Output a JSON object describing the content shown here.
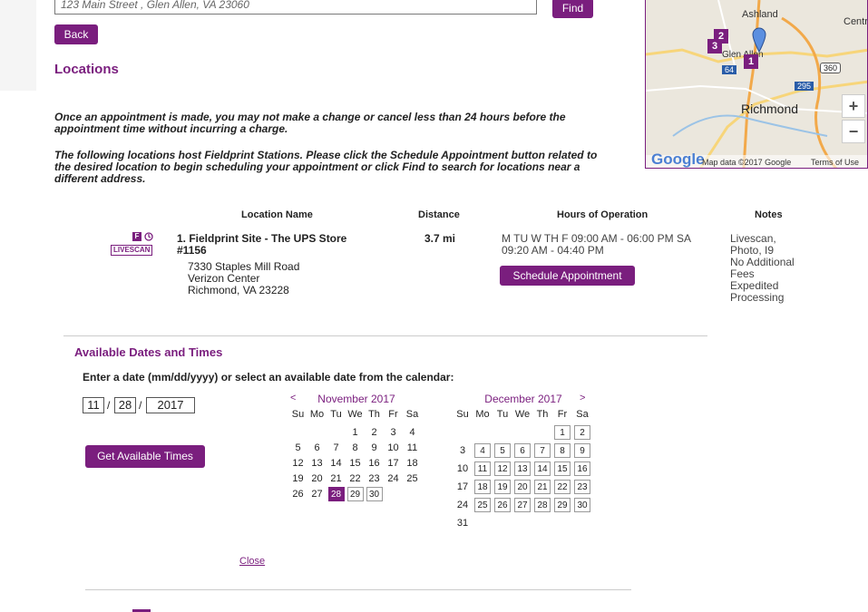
{
  "search": {
    "address_value": "123 Main Street , Glen Allen, VA 23060",
    "find_label": "Find",
    "back_label": "Back"
  },
  "page": {
    "title": "Locations",
    "notice_1": [
      "Once an appointment is made, you may not make a change or cancel less than 24 hours before the",
      "appointment time without incurring a charge."
    ],
    "notice_2": [
      "The following locations host Fieldprint Stations. Please click the Schedule Appointment button related to",
      "the desired location to begin scheduling your appointment or click Find to search for locations near a",
      "different address."
    ]
  },
  "map": {
    "labels": {
      "ashland": "Ashland",
      "centr": "Centr",
      "glen_allen": "Glen Allen",
      "richmond": "Richmond",
      "r360": "360",
      "r64": "64",
      "r295": "295"
    },
    "markers": [
      "2",
      "3",
      "1"
    ],
    "zoom_in": "+",
    "zoom_out": "−",
    "google": "Google",
    "map_data": "Map data ©2017 Google",
    "terms": "Terms of Use"
  },
  "table": {
    "headers": [
      "Location Name",
      "Distance",
      "Hours of Operation",
      "Notes"
    ],
    "row": {
      "f_badge": "F",
      "livescan_badge": "LIVESCAN",
      "name_line1": "1. Fieldprint Site - The UPS Store",
      "name_line2": "#1156",
      "address": [
        "7330 Staples Mill Road",
        "Verizon Center",
        "Richmond, VA 23228"
      ],
      "distance": "3.7 mi",
      "hours": [
        "M TU W TH F 09:00 AM - 06:00 PM SA",
        "09:20 AM - 04:40 PM"
      ],
      "schedule_label": "Schedule Appointment",
      "notes": [
        "Livescan,",
        "Photo, I9",
        "No Additional",
        "Fees",
        "Expedited",
        "Processing"
      ]
    }
  },
  "dates": {
    "title": "Available Dates and Times",
    "instruction": "Enter a date (mm/dd/yyyy) or select an available date from the calendar:",
    "month": "11",
    "day": "28",
    "year": "2017",
    "sep": "/",
    "get_times_label": "Get Available Times",
    "close_label": "Close",
    "dow": [
      "Su",
      "Mo",
      "Tu",
      "We",
      "Th",
      "Fr",
      "Sa"
    ],
    "nov": {
      "label": "November 2017",
      "prev": "<",
      "weeks": [
        [
          "",
          "",
          "",
          "1",
          "2",
          "3",
          "4"
        ],
        [
          "5",
          "6",
          "7",
          "8",
          "9",
          "10",
          "11"
        ],
        [
          "12",
          "13",
          "14",
          "15",
          "16",
          "17",
          "18"
        ],
        [
          "19",
          "20",
          "21",
          "22",
          "23",
          "24",
          "25"
        ],
        [
          "26",
          "27",
          "28",
          "29",
          "30",
          "",
          ""
        ]
      ],
      "avail": [
        "28",
        "29",
        "30"
      ],
      "selected": "28"
    },
    "dec": {
      "label": "December 2017",
      "next": ">",
      "weeks": [
        [
          "",
          "",
          "",
          "",
          "",
          "1",
          "2"
        ],
        [
          "3",
          "4",
          "5",
          "6",
          "7",
          "8",
          "9"
        ],
        [
          "10",
          "11",
          "12",
          "13",
          "14",
          "15",
          "16"
        ],
        [
          "17",
          "18",
          "19",
          "20",
          "21",
          "22",
          "23"
        ],
        [
          "24",
          "25",
          "26",
          "27",
          "28",
          "29",
          "30"
        ],
        [
          "31",
          "",
          "",
          "",
          "",
          "",
          ""
        ]
      ],
      "avail": [
        "1",
        "2",
        "4",
        "5",
        "6",
        "7",
        "8",
        "9",
        "11",
        "12",
        "13",
        "14",
        "15",
        "16",
        "18",
        "19",
        "20",
        "21",
        "22",
        "23",
        "25",
        "26",
        "27",
        "28",
        "29",
        "30"
      ]
    }
  },
  "colors": {
    "brand": "#7a1e7e"
  }
}
